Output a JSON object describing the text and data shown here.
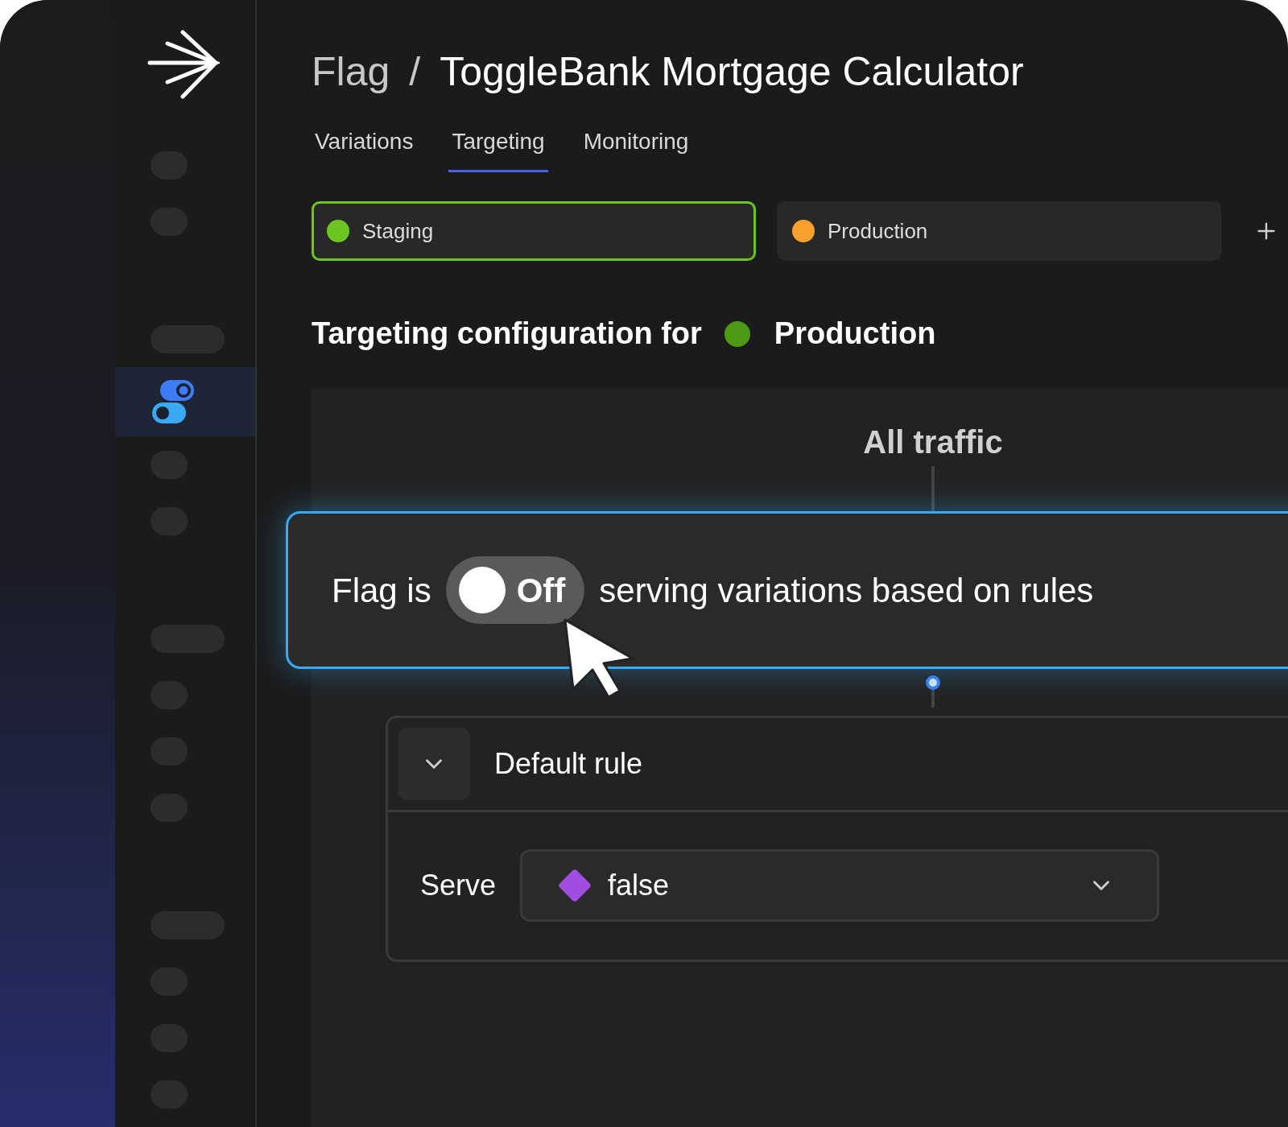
{
  "sidebar": {
    "groups": [
      [
        {
          "kind": "short",
          "selected": false
        },
        {
          "kind": "short",
          "selected": false
        }
      ],
      [
        {
          "kind": "long",
          "selected": false
        },
        {
          "kind": "toggles",
          "selected": true
        },
        {
          "kind": "short",
          "selected": false
        },
        {
          "kind": "short",
          "selected": false
        }
      ],
      [
        {
          "kind": "long",
          "selected": false
        },
        {
          "kind": "short",
          "selected": false
        },
        {
          "kind": "short",
          "selected": false
        },
        {
          "kind": "short",
          "selected": false
        }
      ],
      [
        {
          "kind": "long",
          "selected": false
        },
        {
          "kind": "short",
          "selected": false
        },
        {
          "kind": "short",
          "selected": false
        },
        {
          "kind": "short",
          "selected": false
        }
      ]
    ]
  },
  "breadcrumb": {
    "parent": "Flag",
    "separator": "/",
    "current": "ToggleBank Mortgage Calculator"
  },
  "tabs": [
    {
      "label": "Variations",
      "selected": false
    },
    {
      "label": "Targeting",
      "selected": true
    },
    {
      "label": "Monitoring",
      "selected": false
    }
  ],
  "environments": [
    {
      "name": "Staging",
      "color": "#6cc520",
      "selected": true
    },
    {
      "name": "Production",
      "color": "#f7a02d",
      "selected": false
    }
  ],
  "heading": {
    "prefix": "Targeting configuration for",
    "environment": {
      "name": "Production",
      "color": "#4e9a14"
    }
  },
  "all_traffic": "All traffic",
  "flag_card": {
    "prefix": "Flag is",
    "toggle": {
      "label": "Off",
      "on": false
    },
    "suffix": "serving variations based on rules"
  },
  "default_rule": {
    "title": "Default rule",
    "expanded": true,
    "serve_label": "Serve",
    "variation": {
      "name": "false",
      "color": "#a14ee0"
    }
  }
}
